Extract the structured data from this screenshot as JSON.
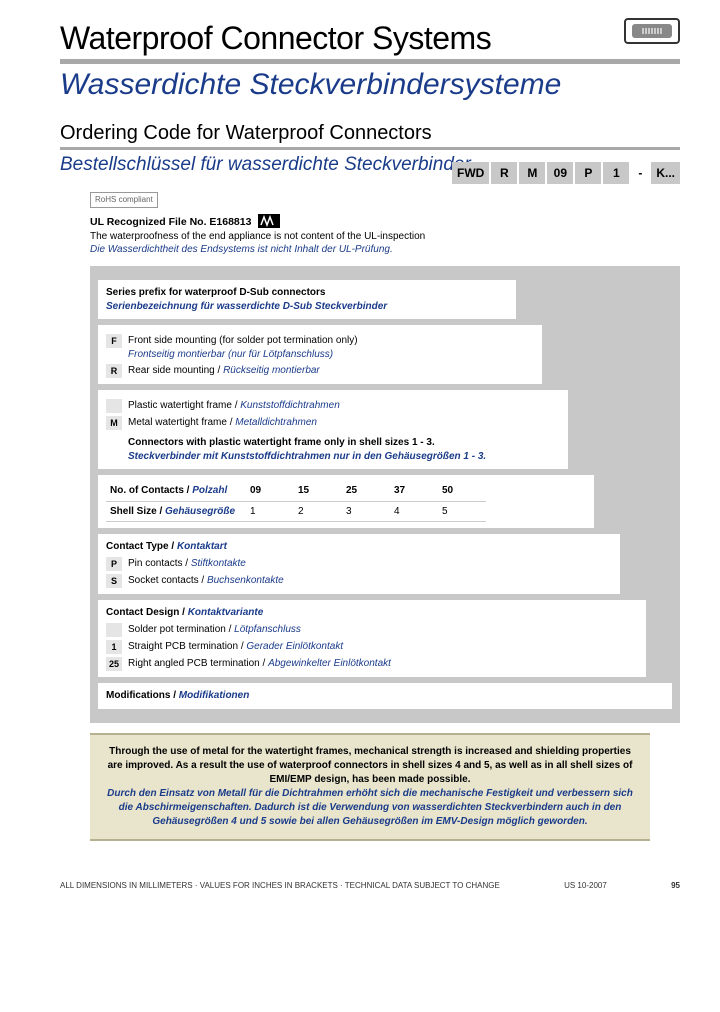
{
  "header": {
    "title_en": "Waterproof Connector Systems",
    "title_de": "Wasserdichte Steckverbindersysteme",
    "section_en": "Ordering Code for Waterproof Connectors",
    "section_de": "Bestellschlüssel für wasserdichte Steckverbinder"
  },
  "ul": {
    "rohs": "RoHS compliant",
    "line1": "UL Recognized File No. E168813",
    "en1": "The waterproofness of the end appliance is not content of the UL-inspection",
    "de1": "Die Wasserdichtheit des Endsystems ist nicht Inhalt der UL-Prüfung."
  },
  "code": {
    "b1": "FWD",
    "b2": "R",
    "b3": "M",
    "b4": "09",
    "b5": "P",
    "b6": "1",
    "dash": "-",
    "b7": "K..."
  },
  "rows": {
    "series": {
      "hdr_en": "Series prefix for waterproof D-Sub connectors",
      "hdr_de": "Serienbezeichnung für wasserdichte D-Sub Steckverbinder"
    },
    "mount": {
      "F_en": "Front side mounting (for solder pot termination only)",
      "F_de": "Frontseitig montierbar (nur für Lötpfanschluss)",
      "R_en": "Rear side mounting / ",
      "R_de": "Rückseitig montierbar"
    },
    "frame": {
      "P_en": "Plastic watertight frame / ",
      "P_de": "Kunststoffdichtrahmen",
      "M_en": "Metal watertight frame / ",
      "M_de": "Metalldichtrahmen",
      "note_en": "Connectors with plastic watertight frame only in shell sizes 1 - 3.",
      "note_de": "Steckverbinder mit Kunststoffdichtrahmen nur in den Gehäusegrößen 1 - 3."
    },
    "contacts": {
      "row1_en": "No. of Contacts / ",
      "row1_de": "Polzahl",
      "row2_en": "Shell Size / ",
      "row2_de": "Gehäusegröße",
      "c1": "09",
      "c2": "15",
      "c3": "25",
      "c4": "37",
      "c5": "50",
      "s1": "1",
      "s2": "2",
      "s3": "3",
      "s4": "4",
      "s5": "5"
    },
    "ctype": {
      "hdr_en": "Contact Type / ",
      "hdr_de": "Kontaktart",
      "P_en": "Pin contacts / ",
      "P_de": "Stiftkontakte",
      "S_en": "Socket contacts / ",
      "S_de": "Buchsenkontakte"
    },
    "cdesign": {
      "hdr_en": "Contact Design / ",
      "hdr_de": "Kontaktvariante",
      "o1_en": "Solder pot termination / ",
      "o1_de": "Lötpfanschluss",
      "o2_en": "Straight PCB termination / ",
      "o2_de": "Gerader Einlötkontakt",
      "o3_en": "Right angled PCB termination / ",
      "o3_de": "Abgewinkelter Einlötkontakt",
      "k1": "1",
      "k2": "25"
    },
    "mods": {
      "hdr_en": "Modifications / ",
      "hdr_de": "Modifikationen"
    }
  },
  "notebox": {
    "en": "Through the use of metal for the watertight frames, mechanical strength is increased and shielding properties are improved. As a result the use of waterproof connectors in shell sizes 4 and 5, as well as in all shell sizes of EMI/EMP design, has been made possible.",
    "de": "Durch den Einsatz von Metall für die Dichtrahmen erhöht sich die mechanische Festigkeit und verbessern sich die Abschirmeigenschaften. Dadurch ist die Verwendung von wasserdichten Steckverbindern auch in den Gehäusegrößen 4 und 5 sowie bei allen Gehäusegrößen im EMV-Design möglich geworden."
  },
  "footer": {
    "left": "ALL DIMENSIONS IN MILLIMETERS · VALUES FOR INCHES IN BRACKETS · TECHNICAL DATA SUBJECT TO CHANGE",
    "mid": "US 10-2007",
    "page": "95"
  }
}
